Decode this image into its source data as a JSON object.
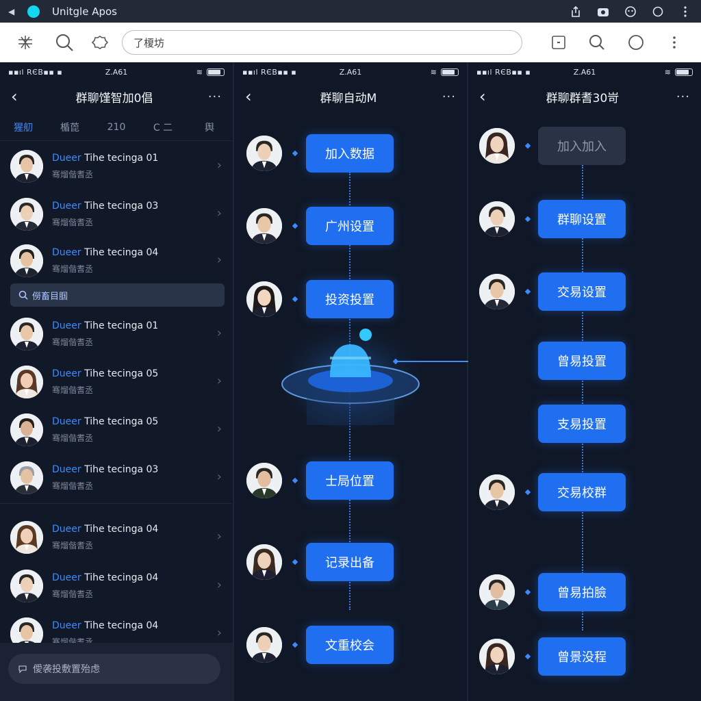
{
  "window": {
    "title": "Unitgle Apos"
  },
  "browser": {
    "address_text": "了榎坊"
  },
  "status_bar": {
    "signal": "▪▪ıl RЄB▪▪ ▪",
    "time": "Z.A61"
  },
  "panel1": {
    "title": "群聊馑智加0倡",
    "tabs": [
      {
        "label": "猩舠"
      },
      {
        "label": "楯萞"
      },
      {
        "label": "210"
      },
      {
        "label": "C 二"
      },
      {
        "label": "舆"
      }
    ],
    "rows": [
      {
        "prefix": "Dueer",
        "name": "Tihe tecinga 01",
        "sub": "骞熘偕耆丞"
      },
      {
        "prefix": "Dueer",
        "name": "Tihe tecinga 03",
        "sub": "骞熘偕耆丞"
      },
      {
        "prefix": "Dueer",
        "name": "Tihe tecinga 04",
        "sub": "骞熘偕耆丞"
      },
      {
        "prefix": "Dueer",
        "name": "Tihe tecinga 01",
        "sub": "骞熘偕耆丞"
      },
      {
        "prefix": "Dueer",
        "name": "Tihe tecinga 05",
        "sub": "骞熘偕耆丞"
      },
      {
        "prefix": "Dueer",
        "name": "Tihe tecinga 05",
        "sub": "骞熘偕耆丞"
      },
      {
        "prefix": "Dueer",
        "name": "Tihe tecinga 03",
        "sub": "骞熘偕耆丞"
      },
      {
        "prefix": "Dueer",
        "name": "Tihe tecinga 04",
        "sub": "骞熘偕耆丞"
      },
      {
        "prefix": "Dueer",
        "name": "Tihe tecinga 04",
        "sub": "骞熘偕耆丞"
      },
      {
        "prefix": "Dueer",
        "name": "Tihe tecinga 04",
        "sub": "骞熘偕耆丞"
      }
    ],
    "search_strip": "僗畜目腘",
    "bottom_input": "僾袭投敷置殆虑"
  },
  "panel2": {
    "title": "群聊自动M",
    "nodes": [
      "加入数据",
      "广州设置",
      "投资投置",
      "士局位置",
      "记录出备",
      "文重校会"
    ]
  },
  "panel3": {
    "title": "群聊群耆30岢",
    "nodes": [
      "加入加入",
      "群聊设置",
      "交易设置",
      "曾易投置",
      "支易投置",
      "交易校群",
      "曾易拍臉",
      "曾景没程"
    ]
  },
  "colors": {
    "accent": "#1f6ff0",
    "link": "#3d8bff",
    "background": "#111928"
  }
}
